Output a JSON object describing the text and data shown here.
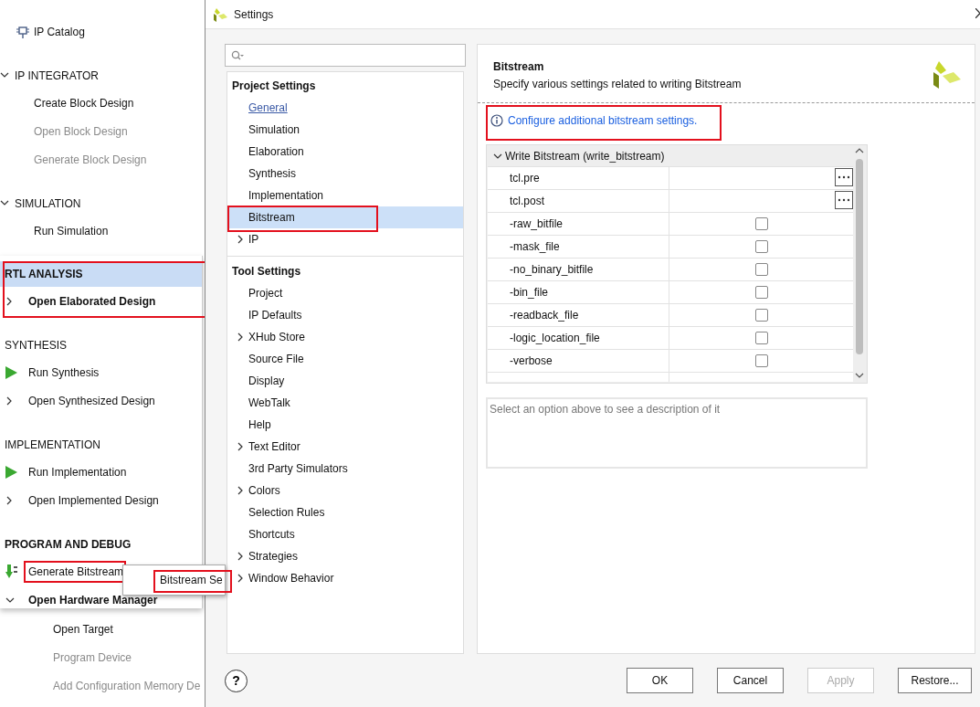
{
  "navigator": {
    "groups": [
      {
        "items": [
          {
            "label": "IP Catalog",
            "kind": "chip",
            "disabled": false
          }
        ]
      },
      {
        "title": "IP INTEGRATOR",
        "expanded": true,
        "items": [
          {
            "label": "Create Block Design",
            "disabled": false
          },
          {
            "label": "Open Block Design",
            "disabled": true
          },
          {
            "label": "Generate Block Design",
            "disabled": true
          }
        ]
      },
      {
        "title": "SIMULATION",
        "expanded": true,
        "items": [
          {
            "label": "Run Simulation",
            "disabled": false
          }
        ]
      }
    ],
    "hardware_manager_children": [
      {
        "label": "Open Target",
        "disabled": false
      },
      {
        "label": "Program Device",
        "disabled": true
      },
      {
        "label": "Add Configuration Memory De",
        "disabled": true
      }
    ]
  },
  "flow_panel": {
    "sections": [
      {
        "title": "RTL ANALYSIS",
        "bold": true,
        "selected": true,
        "highlighted": true,
        "items": [
          {
            "label": "Open Elaborated Design",
            "kind": "chevron-right",
            "bold": true,
            "highlighted": false
          }
        ]
      },
      {
        "title": "SYNTHESIS",
        "bold": false,
        "selected": false,
        "highlighted": false,
        "items": [
          {
            "label": "Run Synthesis",
            "kind": "play",
            "bold": false,
            "highlighted": false
          },
          {
            "label": "Open Synthesized Design",
            "kind": "chevron-right",
            "bold": false,
            "highlighted": false
          }
        ]
      },
      {
        "title": "IMPLEMENTATION",
        "bold": false,
        "selected": false,
        "highlighted": false,
        "items": [
          {
            "label": "Run Implementation",
            "kind": "play",
            "bold": false,
            "highlighted": false
          },
          {
            "label": "Open Implemented Design",
            "kind": "chevron-right",
            "bold": false,
            "highlighted": false
          }
        ]
      },
      {
        "title": "PROGRAM AND DEBUG",
        "bold": true,
        "selected": false,
        "highlighted": false,
        "items": [
          {
            "label": "Generate Bitstream",
            "kind": "bitstream",
            "bold": false,
            "highlighted": true
          },
          {
            "label": "Open Hardware Manager",
            "kind": "chevron-down",
            "bold": true,
            "highlighted": false
          }
        ]
      }
    ]
  },
  "popup_menu": {
    "items": [
      {
        "label": "Bitstream Se",
        "highlighted": true
      }
    ]
  },
  "settings": {
    "title": "Settings",
    "tree": [
      {
        "title": "Project Settings",
        "items": [
          {
            "label": "General",
            "kind": "link",
            "selected": false,
            "expandable": false,
            "highlighted": false
          },
          {
            "label": "Simulation",
            "kind": "plain",
            "selected": false,
            "expandable": false,
            "highlighted": false
          },
          {
            "label": "Elaboration",
            "kind": "plain",
            "selected": false,
            "expandable": false,
            "highlighted": false
          },
          {
            "label": "Synthesis",
            "kind": "plain",
            "selected": false,
            "expandable": false,
            "highlighted": false
          },
          {
            "label": "Implementation",
            "kind": "plain",
            "selected": false,
            "expandable": false,
            "highlighted": false
          },
          {
            "label": "Bitstream",
            "kind": "plain",
            "selected": true,
            "expandable": false,
            "highlighted": true
          },
          {
            "label": "IP",
            "kind": "plain",
            "selected": false,
            "expandable": true,
            "highlighted": false
          }
        ]
      },
      {
        "title": "Tool Settings",
        "items": [
          {
            "label": "Project",
            "kind": "plain",
            "selected": false,
            "expandable": false,
            "highlighted": false
          },
          {
            "label": "IP Defaults",
            "kind": "plain",
            "selected": false,
            "expandable": false,
            "highlighted": false
          },
          {
            "label": "XHub Store",
            "kind": "plain",
            "selected": false,
            "expandable": true,
            "highlighted": false
          },
          {
            "label": "Source File",
            "kind": "plain",
            "selected": false,
            "expandable": false,
            "highlighted": false
          },
          {
            "label": "Display",
            "kind": "plain",
            "selected": false,
            "expandable": false,
            "highlighted": false
          },
          {
            "label": "WebTalk",
            "kind": "plain",
            "selected": false,
            "expandable": false,
            "highlighted": false
          },
          {
            "label": "Help",
            "kind": "plain",
            "selected": false,
            "expandable": false,
            "highlighted": false
          },
          {
            "label": "Text Editor",
            "kind": "plain",
            "selected": false,
            "expandable": true,
            "highlighted": false
          },
          {
            "label": "3rd Party Simulators",
            "kind": "plain",
            "selected": false,
            "expandable": false,
            "highlighted": false
          },
          {
            "label": "Colors",
            "kind": "plain",
            "selected": false,
            "expandable": true,
            "highlighted": false
          },
          {
            "label": "Selection Rules",
            "kind": "plain",
            "selected": false,
            "expandable": false,
            "highlighted": false
          },
          {
            "label": "Shortcuts",
            "kind": "plain",
            "selected": false,
            "expandable": false,
            "highlighted": false
          },
          {
            "label": "Strategies",
            "kind": "plain",
            "selected": false,
            "expandable": true,
            "highlighted": false
          },
          {
            "label": "Window Behavior",
            "kind": "plain",
            "selected": false,
            "expandable": true,
            "highlighted": false
          }
        ]
      }
    ],
    "page": {
      "title": "Bitstream",
      "description": "Specify various settings related to writing Bitstream",
      "info_link": {
        "label": "Configure additional bitstream settings.",
        "highlighted": true
      },
      "table": {
        "group": "Write Bitstream (write_bitstream)",
        "expanded": true,
        "rows": [
          {
            "name": "tcl.pre",
            "kind": "file"
          },
          {
            "name": "tcl.post",
            "kind": "file"
          },
          {
            "name": "-raw_bitfile",
            "kind": "checkbox",
            "checked": false
          },
          {
            "name": "-mask_file",
            "kind": "checkbox",
            "checked": false
          },
          {
            "name": "-no_binary_bitfile",
            "kind": "checkbox",
            "checked": false
          },
          {
            "name": "-bin_file",
            "kind": "checkbox",
            "checked": false
          },
          {
            "name": "-readback_file",
            "kind": "checkbox",
            "checked": false
          },
          {
            "name": "-logic_location_file",
            "kind": "checkbox",
            "checked": false
          },
          {
            "name": "-verbose",
            "kind": "checkbox",
            "checked": false
          }
        ]
      },
      "description_placeholder": "Select an option above to see a description of it"
    },
    "help_button": "?",
    "buttons": [
      {
        "label": "OK",
        "disabled": false
      },
      {
        "label": "Cancel",
        "disabled": false
      },
      {
        "label": "Apply",
        "disabled": true
      },
      {
        "label": "Restore...",
        "disabled": false
      }
    ]
  }
}
